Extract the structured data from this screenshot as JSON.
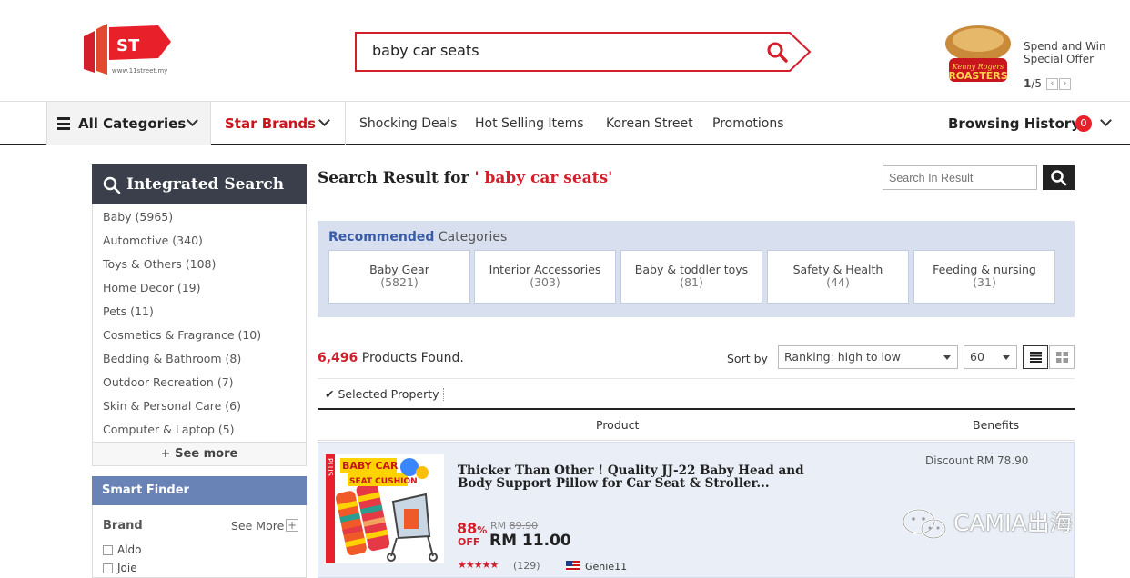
{
  "header": {
    "logo_text": "11ST",
    "logo_url": "www.11street.my",
    "search_value": "baby car seats",
    "promo": {
      "text_line1": "Spend and Win",
      "text_line2": "Special Offer",
      "brand": "Kenny Rogers ROASTERS",
      "pager_current": "1",
      "pager_total": "/5"
    }
  },
  "nav": {
    "all_categories": "All Categories",
    "star_brands": "Star Brands",
    "links": [
      "Shocking Deals",
      "Hot Selling Items",
      "Korean Street",
      "Promotions"
    ],
    "browsing_history": "Browsing History",
    "history_count": "0"
  },
  "sidebar": {
    "title": "Integrated Search",
    "items": [
      "Baby (5965)",
      "Automotive (340)",
      "Toys & Others (108)",
      "Home Decor (19)",
      "Pets (11)",
      "Cosmetics & Fragrance (10)",
      "Bedding & Bathroom (8)",
      "Outdoor Recreation (7)",
      "Skin & Personal Care (6)",
      "Computer & Laptop (5)"
    ],
    "see_more": "+ See more",
    "smart_finder": "Smart Finder",
    "brand_label": "Brand",
    "brand_see_more": "See More",
    "brands": [
      "Aldo",
      "Joie"
    ]
  },
  "main": {
    "result_prefix": "Search Result for",
    "result_query": "' baby car seats'",
    "search_in_result_placeholder": "Search In Result",
    "recommended_bold": "Recommended",
    "recommended_rest": "Categories",
    "rec_categories": [
      {
        "name": "Baby Gear",
        "count": "(5821)"
      },
      {
        "name": "Interior Accessories",
        "count": "(303)"
      },
      {
        "name": "Baby & toddler toys",
        "count": "(81)"
      },
      {
        "name": "Safety & Health",
        "count": "(44)"
      },
      {
        "name": "Feeding & nursing",
        "count": "(31)"
      }
    ],
    "found_count": "6,496",
    "found_text": "Products Found.",
    "sort_by": "Sort by",
    "sort_value": "Ranking: high to low",
    "per_page": "60",
    "selected_property": "Selected Property",
    "col_product": "Product",
    "col_benefits": "Benefits"
  },
  "product": {
    "tag": "PLUS",
    "image_text_line1": "BABY CAR",
    "image_text_line2": "SEAT CUSHION",
    "title": "Thicker Than Other ! Quality JJ-22 Baby Head and Body Support Pillow for Car Seat & Stroller...",
    "discount_pct": "88",
    "pct_sign": "%",
    "off": "OFF",
    "old_price_label": "RM",
    "old_price": "89.90",
    "new_price": "RM 11.00",
    "stars": "★★★★★",
    "reviews": "(129)",
    "seller": "Genie11",
    "discount": "Discount RM 78.90"
  },
  "watermark": "CAMIA出海",
  "colors": {
    "brand_red": "#d11f2b",
    "nav_dark": "#3a3f4b",
    "smart_blue": "#6a83b6",
    "rec_bg": "#d8e0ef"
  }
}
